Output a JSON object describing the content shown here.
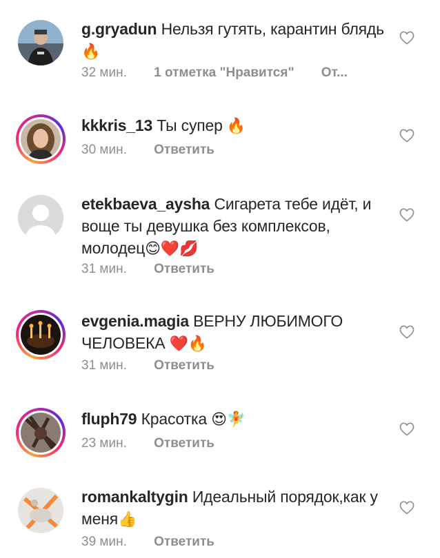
{
  "comments": [
    {
      "username": "g.gryadun",
      "text": "Нельзя гутять, карантин блядь",
      "emoji": "🔥",
      "time": "32 мин.",
      "likes": "1 отметка \"Нравится\"",
      "reply": "От..."
    },
    {
      "username": "kkkris_13",
      "text": "Ты супер",
      "emoji": "🔥",
      "time": "30 мин.",
      "reply": "Ответить"
    },
    {
      "username": "etekbaeva_aysha",
      "text": "Сигарета тебе идёт, и воще ты девушка без комплексов, молодец",
      "emoji": "😊❤️💋",
      "time": "31 мин.",
      "reply": "Ответить"
    },
    {
      "username": "evgenia.magia",
      "text": "ВЕРНУ ЛЮБИМОГО ЧЕЛОВЕКА",
      "emoji": "❤️🔥",
      "time": "31 мин.",
      "reply": "Ответить"
    },
    {
      "username": "fluph79",
      "text": "Красотка",
      "emoji": "😍🧚",
      "time": "23 мин.",
      "reply": "Ответить"
    },
    {
      "username": "romankaltygin",
      "text": "Идеальный порядок,как у меня",
      "emoji": "👍",
      "time": "39 мин.",
      "reply": "Ответить"
    }
  ],
  "colors": {
    "text": "#262626",
    "meta": "#8e8e8e",
    "flame": "#f5a623",
    "heart_red": "#e0245e"
  },
  "icons": {
    "like": "heart-outline-icon"
  }
}
